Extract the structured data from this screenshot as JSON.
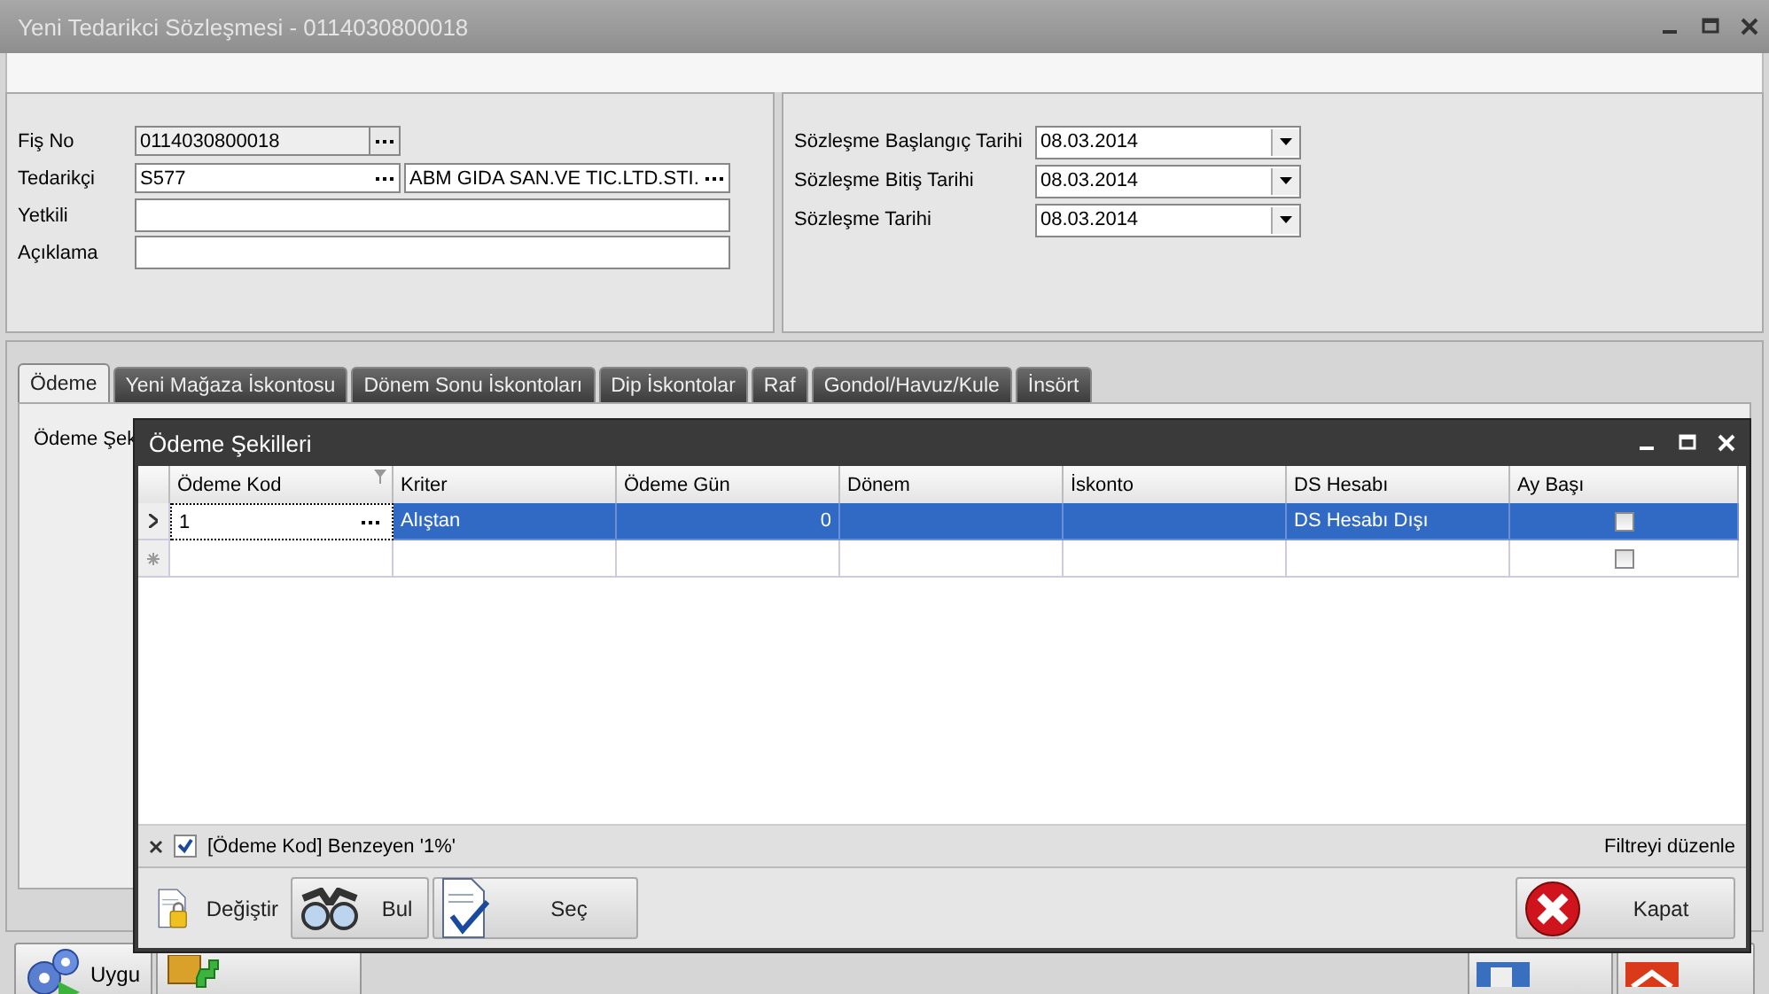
{
  "window": {
    "title": "Yeni Tedarikci Sözleşmesi - 0114030800018"
  },
  "header": {
    "fis_no": {
      "label": "Fiş No",
      "value": "0114030800018"
    },
    "tedarikci": {
      "label": "Tedarikçi",
      "code": "S577",
      "name": "ABM GIDA SAN.VE TIC.LTD.STI."
    },
    "yetkili": {
      "label": "Yetkili"
    },
    "aciklama": {
      "label": "Açıklama"
    },
    "dates": [
      {
        "label": "Sözleşme Başlangıç Tarihi",
        "value": "08.03.2014"
      },
      {
        "label": "Sözleşme Bitiş Tarihi",
        "value": "08.03.2014"
      },
      {
        "label": "Sözleşme Tarihi",
        "value": "08.03.2014"
      }
    ]
  },
  "tabs": [
    {
      "label": "Ödeme",
      "selected": true
    },
    {
      "label": "Yeni Mağaza İskontosu",
      "selected": false
    },
    {
      "label": "Dönem Sonu İskontoları",
      "selected": false
    },
    {
      "label": "Dip İskontolar",
      "selected": false
    },
    {
      "label": "Raf",
      "selected": false
    },
    {
      "label": "Gondol/Havuz/Kule",
      "selected": false
    },
    {
      "label": "İnsört",
      "selected": false
    }
  ],
  "tab_content": {
    "label": "Ödeme Şek"
  },
  "bottom_buttons": [
    {
      "kind": "apply",
      "label": "Uygu"
    },
    {
      "kind": "add"
    },
    {
      "kind": "save"
    },
    {
      "kind": "cancel"
    }
  ],
  "dialog": {
    "title": "Ödeme Şekilleri",
    "columns": [
      {
        "label": "Ödeme Kod",
        "kind": "text",
        "filtered": true
      },
      {
        "label": "Kriter",
        "kind": "text",
        "filtered": false
      },
      {
        "label": "Ödeme Gün",
        "kind": "number",
        "filtered": false
      },
      {
        "label": "Dönem",
        "kind": "text",
        "filtered": false
      },
      {
        "label": "İskonto",
        "kind": "text",
        "filtered": false
      },
      {
        "label": "DS Hesabı",
        "kind": "text",
        "filtered": false
      },
      {
        "label": "Ay Başı",
        "kind": "check",
        "filtered": false
      }
    ],
    "rows": [
      {
        "kind": "current",
        "selected": true,
        "cells": [
          "1",
          "Alıştan",
          "0",
          null,
          null,
          "DS Hesabı Dışı"
        ],
        "checked": false
      },
      {
        "kind": "new",
        "selected": false,
        "cells": [
          null,
          null,
          null,
          null,
          null,
          null
        ],
        "checked": false
      }
    ],
    "filter": {
      "enabled": true,
      "text": "[Ödeme Kod] Benzeyen '1%'",
      "edit_link": "Filtreyi düzenle"
    },
    "buttons": [
      {
        "kind": "edit",
        "label": "Değiştir"
      },
      {
        "kind": "find",
        "label": "Bul"
      },
      {
        "kind": "select",
        "label": "Seç"
      },
      {
        "kind": "close",
        "label": "Kapat"
      }
    ]
  }
}
